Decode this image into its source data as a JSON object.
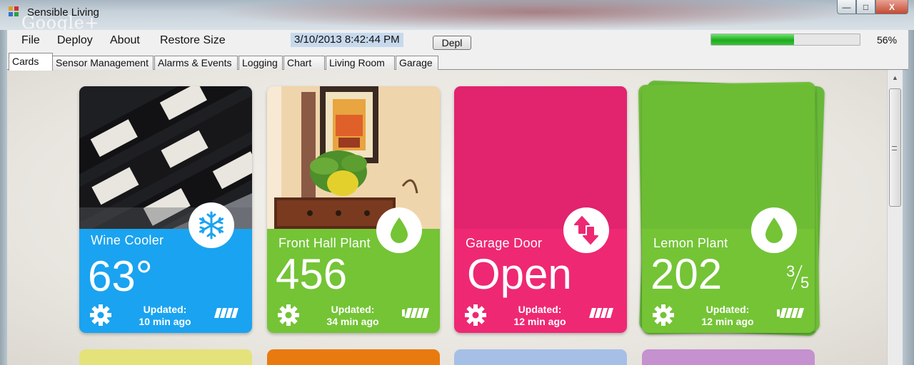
{
  "window": {
    "title": "Sensible Living",
    "overlay_text": "Google+",
    "minimize_label": "—",
    "maximize_label": "□",
    "close_label": "X"
  },
  "menu": {
    "items": [
      "File",
      "Deploy",
      "About",
      "Restore Size"
    ],
    "timestamp": "3/10/2013 8:42:44 PM",
    "depl_button": "Depl",
    "progress_value": 0.56,
    "progress_label": "56%"
  },
  "tabs": [
    "Cards",
    "Sensor Management",
    "Alarms & Events",
    "Logging",
    "Chart",
    "Living Room",
    "Garage"
  ],
  "cards": [
    {
      "name": "Wine Cooler",
      "value": "63°",
      "updated_label": "Updated:",
      "updated_time": "10 min ago",
      "icon": "snowflake-icon",
      "color": "#1aa3f0"
    },
    {
      "name": "Front Hall Plant",
      "value": "456",
      "updated_label": "Updated:",
      "updated_time": "34 min ago",
      "icon": "water-drop-icon",
      "color": "#74c436"
    },
    {
      "name": "Garage Door",
      "value": "Open",
      "updated_label": "Updated:",
      "updated_time": "12 min ago",
      "icon": "up-down-arrows-icon",
      "color": "#ef2873",
      "photo_color": "#e2236e"
    },
    {
      "name": "Lemon Plant",
      "value": "202",
      "fraction_num": "3",
      "fraction_den": "5",
      "updated_label": "Updated:",
      "updated_time": "12 min ago",
      "icon": "water-drop-icon",
      "color": "#74c436",
      "photo_color": "#6cbd34"
    }
  ],
  "row2_colors": [
    "#e4e27a",
    "#e87a10",
    "#a6bfe6",
    "#c591cf"
  ]
}
